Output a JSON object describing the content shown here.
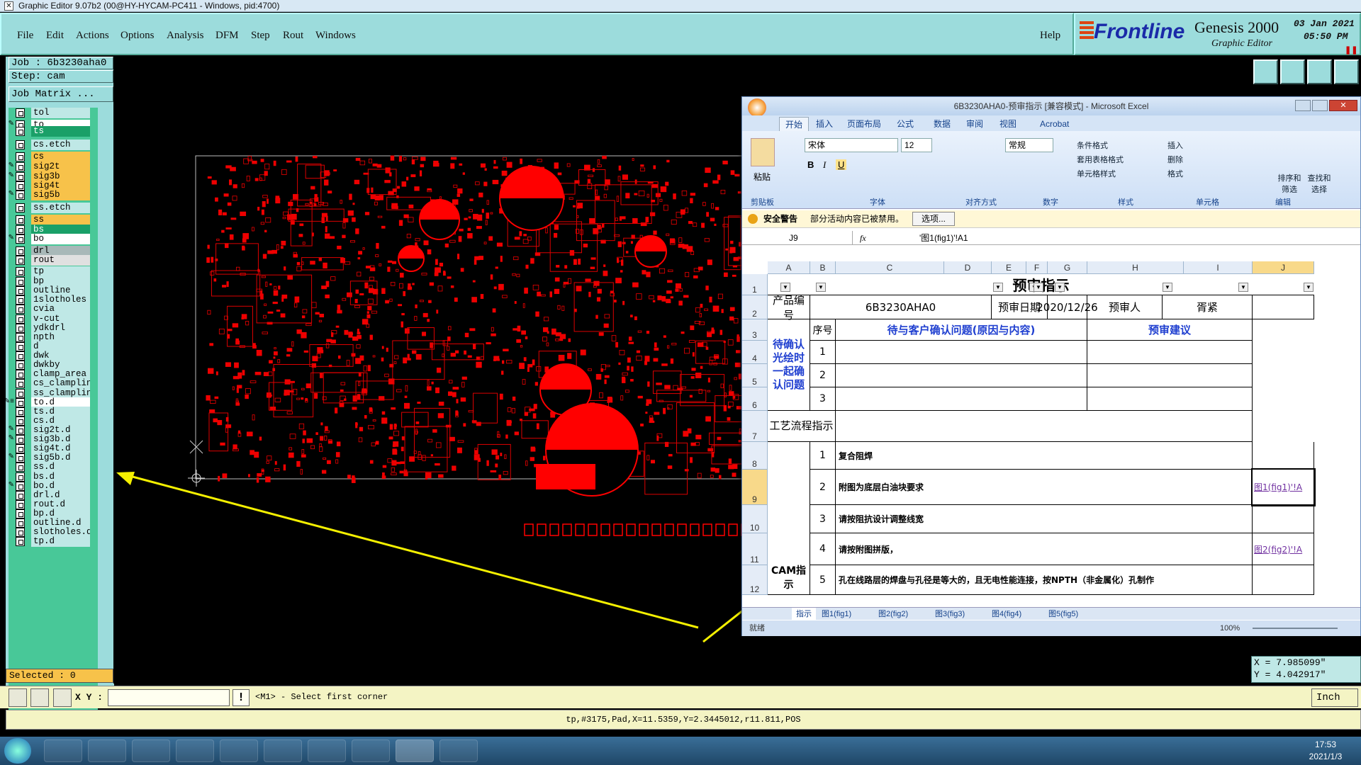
{
  "window_title": "Graphic Editor 9.07b2 (00@HY-HYCAM-PC411 - Windows, pid:4700)",
  "menu": [
    "File",
    "Edit",
    "Actions",
    "Options",
    "Analysis",
    "DFM",
    "Step",
    "Rout",
    "Windows"
  ],
  "help_label": "Help",
  "logo": {
    "brand": "Frontline",
    "product": "Genesis 2000",
    "subtitle": "Graphic Editor",
    "date": "03 Jan 2021",
    "time": "05:50 PM"
  },
  "job": {
    "job_label": "Job : 6b3230aha0",
    "step_label": "Step: cam",
    "matrix_label": "Job Matrix ..."
  },
  "layers": [
    {
      "name": "tol",
      "color": "#bfe8e6",
      "flag": ""
    },
    {
      "name": "to",
      "color": "#ffffff",
      "flag": "✎"
    },
    {
      "name": "ts",
      "color": "#1aa068",
      "flag": ""
    },
    {
      "name": "cs.etch",
      "color": "#bfe8e6",
      "flag": ""
    },
    {
      "name": "cs",
      "color": "#f7c24a",
      "flag": ""
    },
    {
      "name": "sig2t",
      "color": "#f7c24a",
      "flag": "✎"
    },
    {
      "name": "sig3b",
      "color": "#f7c24a",
      "flag": "✎"
    },
    {
      "name": "sig4t",
      "color": "#f7c24a",
      "flag": ""
    },
    {
      "name": "sig5b",
      "color": "#f7c24a",
      "flag": "✎"
    },
    {
      "name": "ss.etch",
      "color": "#bfe8e6",
      "flag": ""
    },
    {
      "name": "ss",
      "color": "#f7c24a",
      "flag": ""
    },
    {
      "name": "bs",
      "color": "#1aa068",
      "flag": ""
    },
    {
      "name": "bo",
      "color": "#ffffff",
      "flag": "✎"
    },
    {
      "name": "drl",
      "color": "#a8b8b8",
      "flag": ""
    },
    {
      "name": "rout",
      "color": "#e0e0e0",
      "flag": ""
    },
    {
      "name": "tp",
      "color": "#bfe8e6",
      "flag": ""
    },
    {
      "name": "bp",
      "color": "#bfe8e6",
      "flag": ""
    },
    {
      "name": "outline",
      "color": "#bfe8e6",
      "flag": ""
    },
    {
      "name": "1slotholes",
      "color": "#bfe8e6",
      "flag": ""
    },
    {
      "name": "cvia",
      "color": "#bfe8e6",
      "flag": ""
    },
    {
      "name": "v-cut",
      "color": "#bfe8e6",
      "flag": ""
    },
    {
      "name": "ydkdrl",
      "color": "#bfe8e6",
      "flag": ""
    },
    {
      "name": "npth",
      "color": "#bfe8e6",
      "flag": ""
    },
    {
      "name": "d",
      "color": "#bfe8e6",
      "flag": ""
    },
    {
      "name": "dwk",
      "color": "#bfe8e6",
      "flag": ""
    },
    {
      "name": "dwkby",
      "color": "#bfe8e6",
      "flag": ""
    },
    {
      "name": "clamp_area",
      "color": "#bfe8e6",
      "flag": ""
    },
    {
      "name": "cs_clampline",
      "color": "#bfe8e6",
      "flag": ""
    },
    {
      "name": "ss_clampline",
      "color": "#bfe8e6",
      "flag": ""
    },
    {
      "name": "to.d",
      "color": "#ffffff",
      "flag": "✎≡"
    },
    {
      "name": "ts.d",
      "color": "#bfe8e6",
      "flag": ""
    },
    {
      "name": "cs.d",
      "color": "#bfe8e6",
      "flag": ""
    },
    {
      "name": "sig2t.d",
      "color": "#bfe8e6",
      "flag": "✎"
    },
    {
      "name": "sig3b.d",
      "color": "#bfe8e6",
      "flag": "✎"
    },
    {
      "name": "sig4t.d",
      "color": "#bfe8e6",
      "flag": ""
    },
    {
      "name": "sig5b.d",
      "color": "#bfe8e6",
      "flag": "✎"
    },
    {
      "name": "ss.d",
      "color": "#bfe8e6",
      "flag": ""
    },
    {
      "name": "bs.d",
      "color": "#bfe8e6",
      "flag": ""
    },
    {
      "name": "bo.d",
      "color": "#bfe8e6",
      "flag": "✎"
    },
    {
      "name": "drl.d",
      "color": "#bfe8e6",
      "flag": ""
    },
    {
      "name": "rout.d",
      "color": "#bfe8e6",
      "flag": ""
    },
    {
      "name": "bp.d",
      "color": "#bfe8e6",
      "flag": ""
    },
    {
      "name": "outline.d",
      "color": "#bfe8e6",
      "flag": ""
    },
    {
      "name": "slotholes.d",
      "color": "#bfe8e6",
      "flag": ""
    },
    {
      "name": "tp.d",
      "color": "#bfe8e6",
      "flag": ""
    }
  ],
  "selected_label": "Selected : 0",
  "coords": {
    "x": "X = 7.985099\"",
    "y": "Y = 4.042917\""
  },
  "command": {
    "xy_label": "X Y :",
    "input_value": "",
    "prompt": "<M1> - Select first corner",
    "units": "Inch"
  },
  "status_line": "tp,#3175,Pad,X=11.5359,Y=2.3445012,r11.811,POS",
  "excel": {
    "title": "6B3230AHA0-预审指示 [兼容模式] - Microsoft Excel",
    "tabs": [
      "开始",
      "插入",
      "页面布局",
      "公式",
      "数据",
      "审阅",
      "视图",
      "Acrobat"
    ],
    "font_name": "宋体",
    "font_size": "12",
    "number_format": "常规",
    "groups": [
      "剪贴板",
      "字体",
      "对齐方式",
      "数字",
      "样式",
      "单元格",
      "编辑"
    ],
    "paste_label": "粘贴",
    "style_btns": [
      "条件格式",
      "套用表格格式",
      "单元格样式"
    ],
    "cell_btns": [
      "插入",
      "删除",
      "格式"
    ],
    "edit_btns": [
      "排序和筛选",
      "查找和选择"
    ],
    "security_title": "安全警告",
    "security_msg": "部分活动内容已被禁用。",
    "options_btn": "选项...",
    "name_box": "J9",
    "formula": "'图1(fig1)'!A1",
    "columns": [
      "A",
      "B",
      "C",
      "D",
      "E",
      "F",
      "G",
      "H",
      "I",
      "J"
    ],
    "rows": [
      "1",
      "2",
      "3",
      "4",
      "5",
      "6",
      "7",
      "8",
      "9",
      "10",
      "11",
      "12"
    ],
    "sheet_title": "预审指示",
    "label_product": "产品编号",
    "product_no": "6B3230AHA0",
    "label_date": "预审日期",
    "date": "2020/12/26",
    "label_reviewer": "预审人",
    "reviewer": "胥紧",
    "label_seq": "序号",
    "label_issue": "待与客户确认问题(原因与内容)",
    "label_advice": "预审建议",
    "label_confirm": "待确认光绘时一起确认问题",
    "seq": [
      "1",
      "2",
      "3"
    ],
    "label_process": "工艺流程指示",
    "label_cam": "CAM指示",
    "instructions": [
      {
        "n": "1",
        "text": "复合阻焊",
        "link": ""
      },
      {
        "n": "2",
        "text": "附图为底层白油块要求",
        "link": "图1(fig1)'!A"
      },
      {
        "n": "3",
        "text": "请按阻抗设计调整线宽",
        "link": ""
      },
      {
        "n": "4",
        "text": "请按附图拼版，",
        "link": "图2(fig2)'!A"
      },
      {
        "n": "5",
        "text": "孔在线路层的焊盘与孔径是等大的，且无电性能连接，按NPTH（非金属化）孔制作",
        "link": ""
      }
    ],
    "sheet_tabs": [
      "指示",
      "图1(fig1)",
      "图2(fig2)",
      "图3(fig3)",
      "图4(fig4)",
      "图5(fig5)"
    ],
    "status_ready": "就绪",
    "zoom": "100%"
  },
  "taskbar": {
    "time": "17:53",
    "date": "2021/1/3"
  }
}
